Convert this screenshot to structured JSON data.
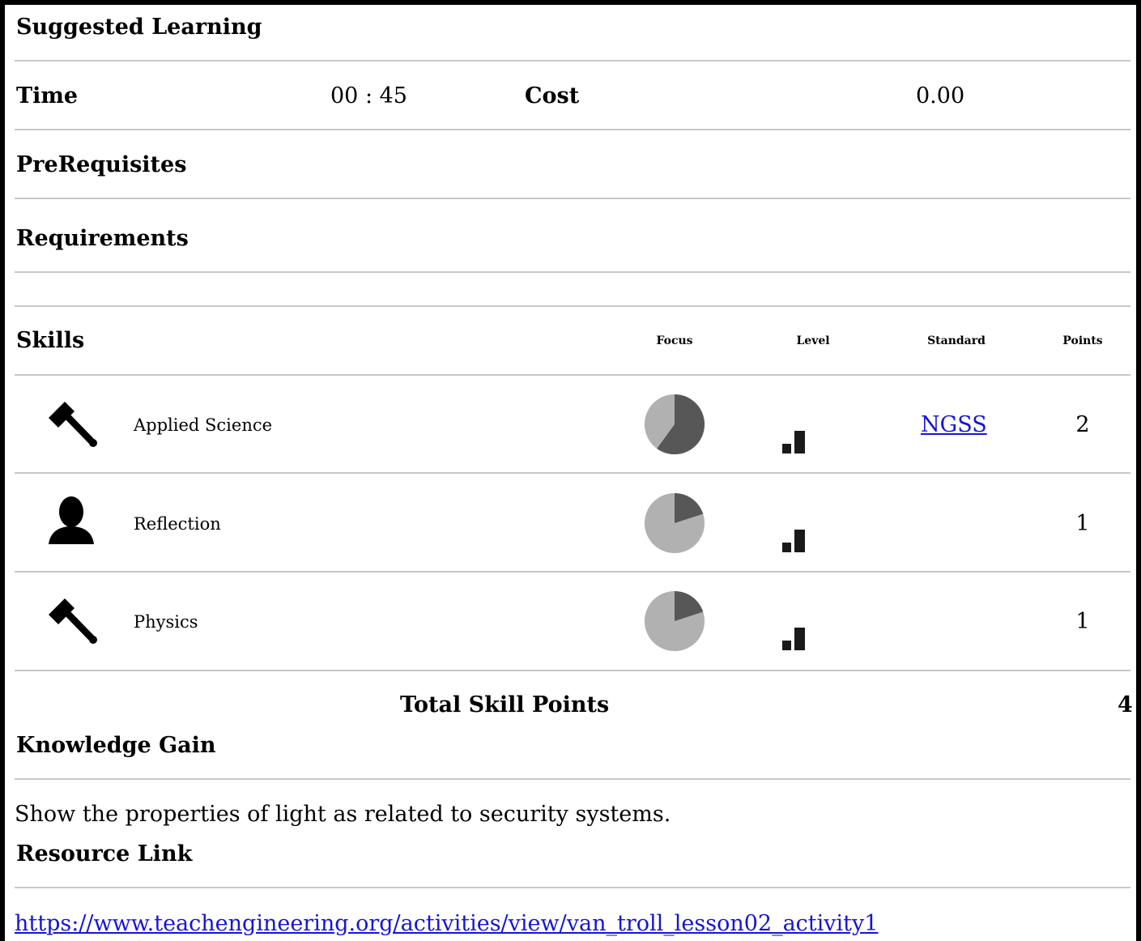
{
  "sections": {
    "suggested_learning": "Suggested Learning",
    "time_label": "Time",
    "time_value": "00 : 45",
    "cost_label": "Cost",
    "cost_value": "0.00",
    "prerequisites": "PreRequisites",
    "requirements": "Requirements",
    "skills": "Skills",
    "total_label": "Total Skill Points",
    "total_value": "4",
    "knowledge_label": "Knowledge Gain",
    "knowledge_text": "Show the properties of light as related to security systems.",
    "resource_label": "Resource Link",
    "resource_url": "https://www.teachengineering.org/activities/view/van_troll_lesson02_activity1"
  },
  "columns": {
    "focus": "Focus",
    "level": "Level",
    "standard": "Standard",
    "points": "Points"
  },
  "skills": [
    {
      "name": "Applied Science",
      "icon": "hammer-icon",
      "focus_fraction": 0.6,
      "level": 2,
      "standard": "NGSS",
      "points": "2"
    },
    {
      "name": "Reflection",
      "icon": "person-icon",
      "focus_fraction": 0.2,
      "level": 2,
      "standard": "",
      "points": "1"
    },
    {
      "name": "Physics",
      "icon": "hammer-icon",
      "focus_fraction": 0.2,
      "level": 2,
      "standard": "",
      "points": "1"
    }
  ],
  "colors": {
    "pie_light": "#b1b1b1",
    "pie_dark": "#575757",
    "link": "#1515d6",
    "divider": "#c8c8c8"
  }
}
